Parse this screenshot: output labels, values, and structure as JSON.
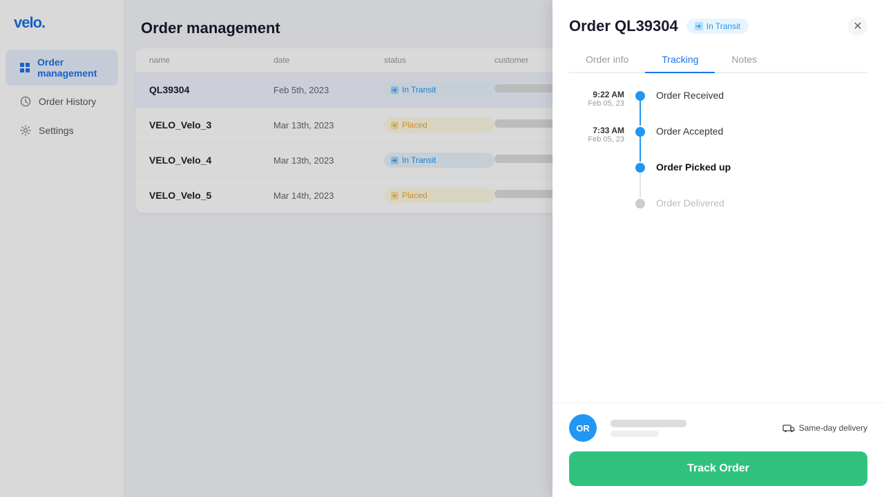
{
  "app": {
    "logo": "velo.",
    "page_title": "Order management"
  },
  "sidebar": {
    "items": [
      {
        "id": "order-management",
        "label": "Order management",
        "icon": "📦",
        "active": true
      },
      {
        "id": "order-history",
        "label": "Order History",
        "icon": "🕐",
        "active": false
      },
      {
        "id": "settings",
        "label": "Settings",
        "icon": "⚙️",
        "active": false
      }
    ]
  },
  "table": {
    "columns": [
      "name",
      "Date",
      "Status",
      "Customer"
    ],
    "rows": [
      {
        "name": "QL39304",
        "date": "Feb 5th, 2023",
        "status": "In Transit",
        "status_type": "transit",
        "customer_blur": true,
        "selected": true
      },
      {
        "name": "VELO_Velo_3",
        "date": "Mar 13th, 2023",
        "status": "Placed",
        "status_type": "placed",
        "customer_blur": true,
        "selected": false
      },
      {
        "name": "VELO_Velo_4",
        "date": "Mar 13th, 2023",
        "status": "In Transit",
        "status_type": "transit",
        "customer_blur": true,
        "selected": false
      },
      {
        "name": "VELO_Velo_5",
        "date": "Mar 14th, 2023",
        "status": "Placed",
        "status_type": "placed",
        "customer_blur": true,
        "selected": false
      }
    ]
  },
  "panel": {
    "order_id": "Order QL39304",
    "status_badge": "In Transit",
    "close_icon": "✕",
    "tabs": [
      {
        "id": "order-info",
        "label": "Order info",
        "active": false
      },
      {
        "id": "tracking",
        "label": "Tracking",
        "active": true
      },
      {
        "id": "notes",
        "label": "Notes",
        "active": false
      }
    ],
    "tracking": {
      "steps": [
        {
          "time": "9:22 AM",
          "date": "Feb 05, 23",
          "label": "Order Received",
          "state": "done"
        },
        {
          "time": "7:33 AM",
          "date": "Feb 05, 23",
          "label": "Order Accepted",
          "state": "done"
        },
        {
          "time": "",
          "date": "",
          "label": "Order Picked up",
          "state": "current"
        },
        {
          "time": "",
          "date": "",
          "label": "Order Delivered",
          "state": "inactive"
        }
      ]
    },
    "customer": {
      "initials": "OR",
      "delivery_label": "Same-day delivery"
    },
    "track_button_label": "Track Order"
  }
}
